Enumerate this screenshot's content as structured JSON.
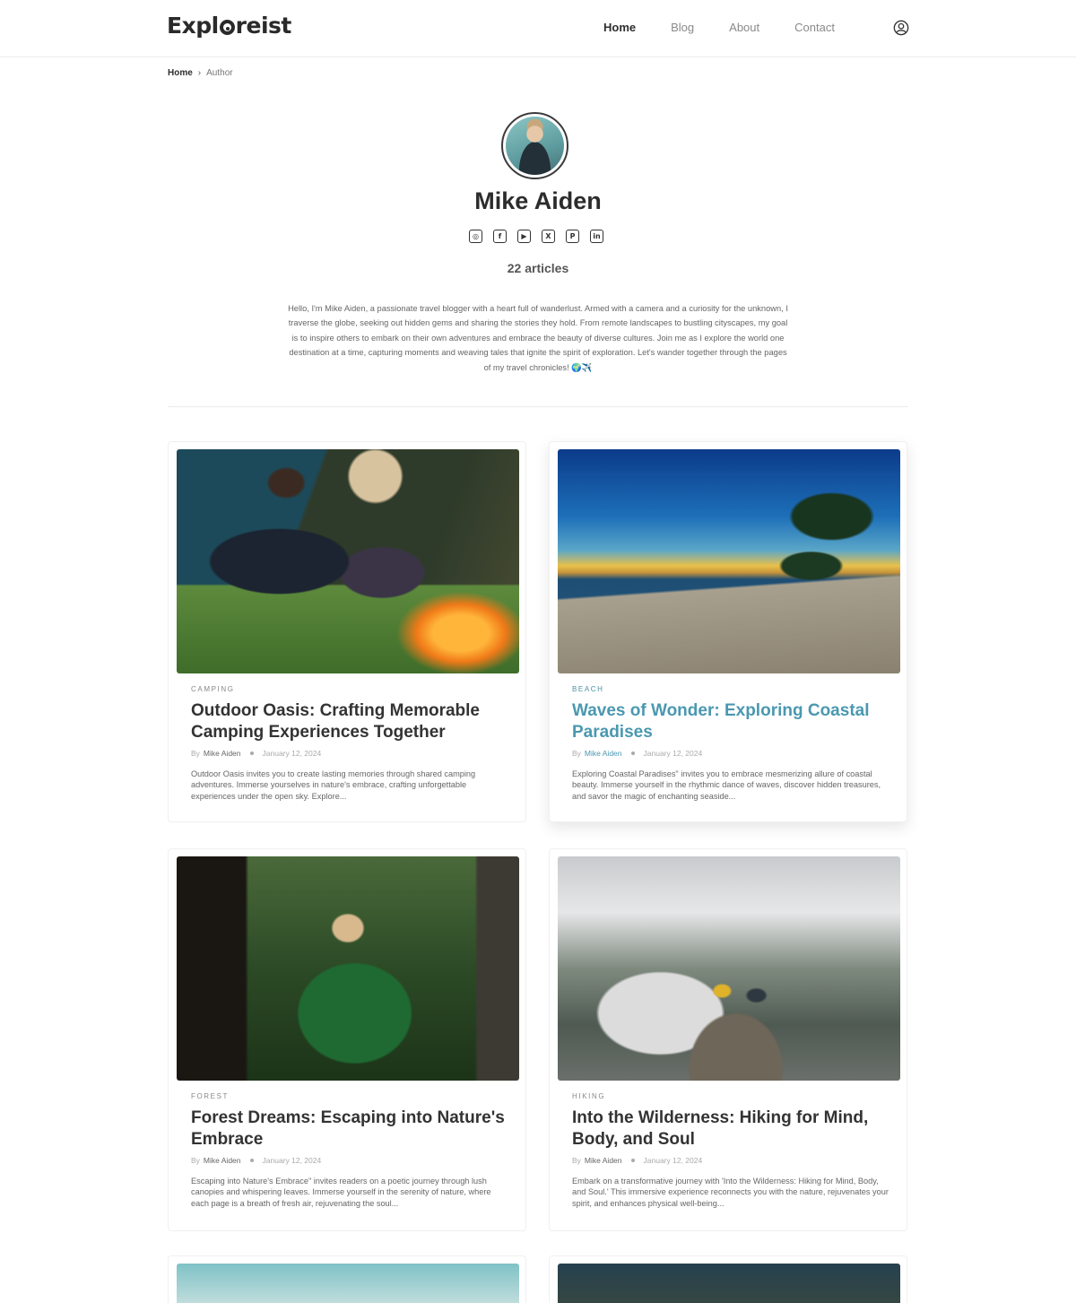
{
  "header": {
    "logo_left": "Expl",
    "logo_right": "reist",
    "nav": [
      {
        "label": "Home"
      },
      {
        "label": "Blog"
      },
      {
        "label": "About"
      },
      {
        "label": "Contact"
      }
    ]
  },
  "breadcrumb": {
    "home": "Home",
    "current": "Author"
  },
  "author": {
    "name": "Mike Aiden",
    "article_count": "22 articles",
    "bio": "Hello, I'm Mike Aiden, a passionate travel blogger with a heart full of wanderlust. Armed with a camera and a curiosity for the unknown, I traverse the globe, seeking out hidden gems and sharing the stories they hold. From remote landscapes to bustling cityscapes, my goal is to inspire others to embark on their own adventures and embrace the beauty of diverse cultures. Join me as I explore the world one destination at a time, capturing moments and weaving tales that ignite the spirit of exploration. Let's wander together through the pages of my travel chronicles! 🌍✈️",
    "socials": [
      {
        "icon": "instagram-icon",
        "glyph": "◎"
      },
      {
        "icon": "facebook-icon",
        "glyph": "f"
      },
      {
        "icon": "youtube-icon",
        "glyph": "▶"
      },
      {
        "icon": "x-twitter-icon",
        "glyph": "X"
      },
      {
        "icon": "pinterest-icon",
        "glyph": "P"
      },
      {
        "icon": "linkedin-icon",
        "glyph": "in"
      }
    ]
  },
  "posts": [
    {
      "category": "CAMPING",
      "title": "Outdoor Oasis: Crafting Memorable Camping Experiences Together",
      "by": "By",
      "author": "Mike Aiden",
      "date": "January 12, 2024",
      "excerpt": "Outdoor Oasis invites you to create lasting memories through shared camping adventures. Immerse yourselves in nature's embrace, crafting unforgettable experiences under the open sky. Explore..."
    },
    {
      "category": "BEACH",
      "title": "Waves of Wonder: Exploring Coastal Paradises",
      "by": "By",
      "author": "Mike Aiden",
      "date": "January 12, 2024",
      "excerpt": "Exploring Coastal Paradises\" invites you to embrace mesmerizing allure of coastal beauty. Immerse yourself in the rhythmic dance of waves, discover hidden treasures, and savor the magic of enchanting seaside..."
    },
    {
      "category": "FOREST",
      "title": "Forest Dreams: Escaping into Nature's Embrace",
      "by": "By",
      "author": "Mike Aiden",
      "date": "January 12, 2024",
      "excerpt": "Escaping into Nature's Embrace\" invites readers on a poetic journey through lush canopies and whispering leaves. Immerse yourself in the serenity of nature, where each page is a breath of fresh air, rejuvenating the soul..."
    },
    {
      "category": "HIKING",
      "title": "Into the Wilderness: Hiking for Mind, Body, and Soul",
      "by": "By",
      "author": "Mike Aiden",
      "date": "January 12, 2024",
      "excerpt": "Embark on a transformative journey with 'Into the Wilderness: Hiking for Mind, Body, and Soul.' This immersive experience reconnects you with the nature, rejuvenates your spirit, and enhances physical well-being..."
    }
  ],
  "colors": {
    "accent": "#4a98b0",
    "text": "#333333",
    "muted": "#888888"
  }
}
